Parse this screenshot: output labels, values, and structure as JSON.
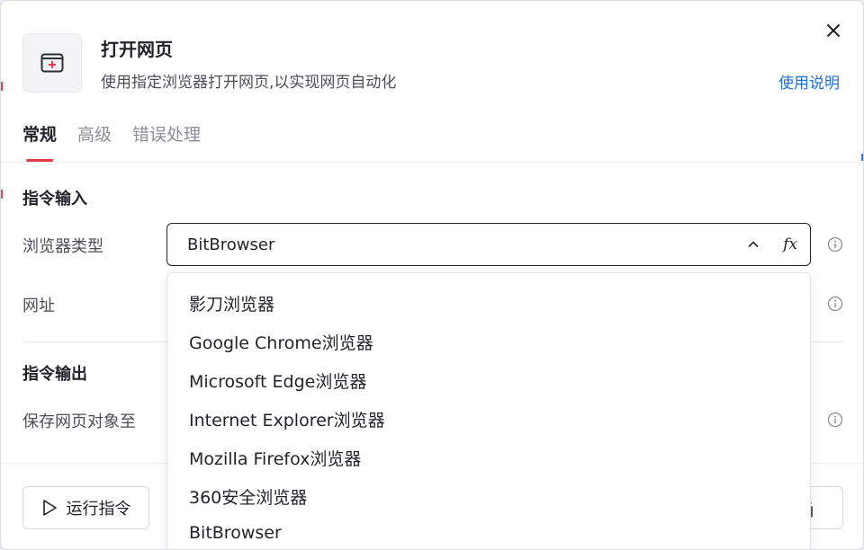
{
  "dialog": {
    "title": "打开网页",
    "subtitle": "使用指定浏览器打开网页,以实现网页自动化",
    "help_link": "使用说明",
    "icon": "open-webpage-icon",
    "close_icon": "close-icon"
  },
  "tabs": [
    {
      "label": "常规",
      "active": true
    },
    {
      "label": "高级",
      "active": false
    },
    {
      "label": "错误处理",
      "active": false
    }
  ],
  "input_section": {
    "title": "指令输入",
    "browser_type": {
      "label": "浏览器类型",
      "value": "BitBrowser",
      "fx_label": "fx"
    },
    "url": {
      "label": "网址"
    }
  },
  "output_section": {
    "title": "指令输出",
    "save_to": {
      "label": "保存网页对象至"
    }
  },
  "dropdown": {
    "options": [
      "影刀浏览器",
      "Google Chrome浏览器",
      "Microsoft Edge浏览器",
      "Internet Explorer浏览器",
      "Mozilla Firefox浏览器",
      "360安全浏览器",
      "BitBrowser"
    ]
  },
  "footer": {
    "run_label": "运行指令",
    "right_button_partial": "甬"
  },
  "colors": {
    "accent_red": "#e3394a",
    "link_blue": "#1f6fd6"
  }
}
